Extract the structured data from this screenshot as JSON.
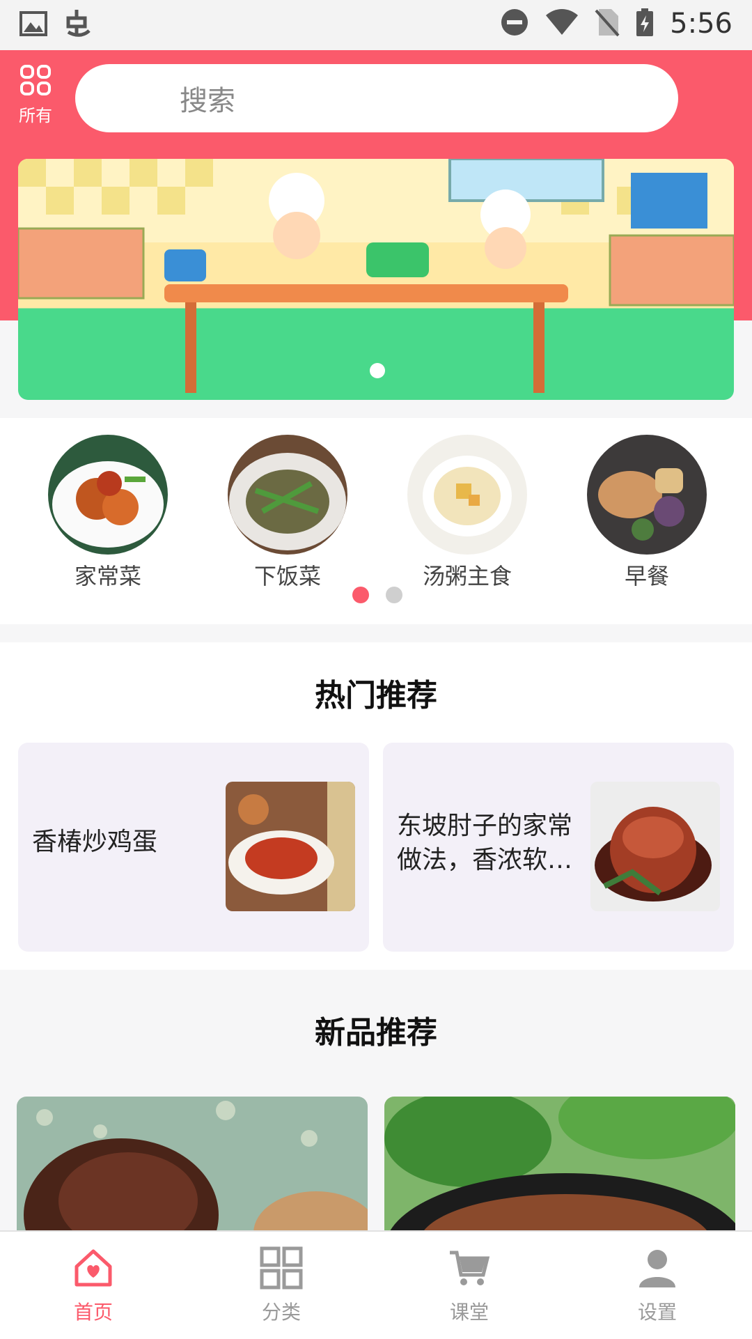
{
  "status": {
    "time": "5:56"
  },
  "header": {
    "all_label": "所有",
    "search_placeholder": "搜索"
  },
  "categories": [
    {
      "label": "家常菜",
      "icon": "dish-home-style"
    },
    {
      "label": "下饭菜",
      "icon": "dish-rice"
    },
    {
      "label": "汤粥主食",
      "icon": "dish-soup"
    },
    {
      "label": "早餐",
      "icon": "dish-breakfast"
    }
  ],
  "hot": {
    "title": "热门推荐",
    "items": [
      {
        "title": "香椿炒鸡蛋"
      },
      {
        "title": "东坡肘子的家常做法，香浓软…"
      }
    ]
  },
  "new": {
    "title": "新品推荐"
  },
  "nav": {
    "items": [
      {
        "label": "首页"
      },
      {
        "label": "分类"
      },
      {
        "label": "课堂"
      },
      {
        "label": "设置"
      }
    ],
    "active_color": "#fb5a6b",
    "inactive_color": "#9a9a9a"
  },
  "colors": {
    "brand": "#fb5a6b",
    "page_bg": "#f6f6f7",
    "card_bg": "#f3f0f8"
  }
}
